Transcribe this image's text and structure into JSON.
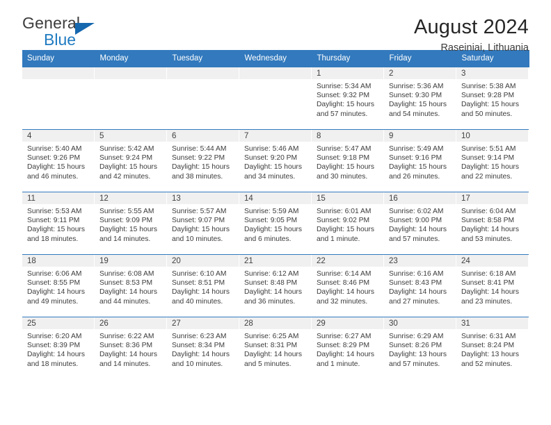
{
  "brand": {
    "name_line1": "General",
    "name_line2": "Blue",
    "triangle_icon": "blue-triangle-logo-mark",
    "color_dark": "#3c3c3c",
    "color_blue": "#1f7bc1"
  },
  "header": {
    "title": "August 2024",
    "subtitle": "Raseiniai, Lithuania"
  },
  "theme": {
    "header_band": "#3279bd",
    "daynum_band": "#f0f0f0",
    "text": "#3b3b3b"
  },
  "weekdays": [
    "Sunday",
    "Monday",
    "Tuesday",
    "Wednesday",
    "Thursday",
    "Friday",
    "Saturday"
  ],
  "labels": {
    "sunrise_prefix": "Sunrise:",
    "sunset_prefix": "Sunset:",
    "daylight_prefix": "Daylight:"
  },
  "weeks": [
    [
      {
        "day": "",
        "sunrise": "",
        "sunset": "",
        "daylight_line1": "",
        "daylight_line2": ""
      },
      {
        "day": "",
        "sunrise": "",
        "sunset": "",
        "daylight_line1": "",
        "daylight_line2": ""
      },
      {
        "day": "",
        "sunrise": "",
        "sunset": "",
        "daylight_line1": "",
        "daylight_line2": ""
      },
      {
        "day": "",
        "sunrise": "",
        "sunset": "",
        "daylight_line1": "",
        "daylight_line2": ""
      },
      {
        "day": "1",
        "sunrise": "Sunrise: 5:34 AM",
        "sunset": "Sunset: 9:32 PM",
        "daylight_line1": "Daylight: 15 hours",
        "daylight_line2": "and 57 minutes."
      },
      {
        "day": "2",
        "sunrise": "Sunrise: 5:36 AM",
        "sunset": "Sunset: 9:30 PM",
        "daylight_line1": "Daylight: 15 hours",
        "daylight_line2": "and 54 minutes."
      },
      {
        "day": "3",
        "sunrise": "Sunrise: 5:38 AM",
        "sunset": "Sunset: 9:28 PM",
        "daylight_line1": "Daylight: 15 hours",
        "daylight_line2": "and 50 minutes."
      }
    ],
    [
      {
        "day": "4",
        "sunrise": "Sunrise: 5:40 AM",
        "sunset": "Sunset: 9:26 PM",
        "daylight_line1": "Daylight: 15 hours",
        "daylight_line2": "and 46 minutes."
      },
      {
        "day": "5",
        "sunrise": "Sunrise: 5:42 AM",
        "sunset": "Sunset: 9:24 PM",
        "daylight_line1": "Daylight: 15 hours",
        "daylight_line2": "and 42 minutes."
      },
      {
        "day": "6",
        "sunrise": "Sunrise: 5:44 AM",
        "sunset": "Sunset: 9:22 PM",
        "daylight_line1": "Daylight: 15 hours",
        "daylight_line2": "and 38 minutes."
      },
      {
        "day": "7",
        "sunrise": "Sunrise: 5:46 AM",
        "sunset": "Sunset: 9:20 PM",
        "daylight_line1": "Daylight: 15 hours",
        "daylight_line2": "and 34 minutes."
      },
      {
        "day": "8",
        "sunrise": "Sunrise: 5:47 AM",
        "sunset": "Sunset: 9:18 PM",
        "daylight_line1": "Daylight: 15 hours",
        "daylight_line2": "and 30 minutes."
      },
      {
        "day": "9",
        "sunrise": "Sunrise: 5:49 AM",
        "sunset": "Sunset: 9:16 PM",
        "daylight_line1": "Daylight: 15 hours",
        "daylight_line2": "and 26 minutes."
      },
      {
        "day": "10",
        "sunrise": "Sunrise: 5:51 AM",
        "sunset": "Sunset: 9:14 PM",
        "daylight_line1": "Daylight: 15 hours",
        "daylight_line2": "and 22 minutes."
      }
    ],
    [
      {
        "day": "11",
        "sunrise": "Sunrise: 5:53 AM",
        "sunset": "Sunset: 9:11 PM",
        "daylight_line1": "Daylight: 15 hours",
        "daylight_line2": "and 18 minutes."
      },
      {
        "day": "12",
        "sunrise": "Sunrise: 5:55 AM",
        "sunset": "Sunset: 9:09 PM",
        "daylight_line1": "Daylight: 15 hours",
        "daylight_line2": "and 14 minutes."
      },
      {
        "day": "13",
        "sunrise": "Sunrise: 5:57 AM",
        "sunset": "Sunset: 9:07 PM",
        "daylight_line1": "Daylight: 15 hours",
        "daylight_line2": "and 10 minutes."
      },
      {
        "day": "14",
        "sunrise": "Sunrise: 5:59 AM",
        "sunset": "Sunset: 9:05 PM",
        "daylight_line1": "Daylight: 15 hours",
        "daylight_line2": "and 6 minutes."
      },
      {
        "day": "15",
        "sunrise": "Sunrise: 6:01 AM",
        "sunset": "Sunset: 9:02 PM",
        "daylight_line1": "Daylight: 15 hours",
        "daylight_line2": "and 1 minute."
      },
      {
        "day": "16",
        "sunrise": "Sunrise: 6:02 AM",
        "sunset": "Sunset: 9:00 PM",
        "daylight_line1": "Daylight: 14 hours",
        "daylight_line2": "and 57 minutes."
      },
      {
        "day": "17",
        "sunrise": "Sunrise: 6:04 AM",
        "sunset": "Sunset: 8:58 PM",
        "daylight_line1": "Daylight: 14 hours",
        "daylight_line2": "and 53 minutes."
      }
    ],
    [
      {
        "day": "18",
        "sunrise": "Sunrise: 6:06 AM",
        "sunset": "Sunset: 8:55 PM",
        "daylight_line1": "Daylight: 14 hours",
        "daylight_line2": "and 49 minutes."
      },
      {
        "day": "19",
        "sunrise": "Sunrise: 6:08 AM",
        "sunset": "Sunset: 8:53 PM",
        "daylight_line1": "Daylight: 14 hours",
        "daylight_line2": "and 44 minutes."
      },
      {
        "day": "20",
        "sunrise": "Sunrise: 6:10 AM",
        "sunset": "Sunset: 8:51 PM",
        "daylight_line1": "Daylight: 14 hours",
        "daylight_line2": "and 40 minutes."
      },
      {
        "day": "21",
        "sunrise": "Sunrise: 6:12 AM",
        "sunset": "Sunset: 8:48 PM",
        "daylight_line1": "Daylight: 14 hours",
        "daylight_line2": "and 36 minutes."
      },
      {
        "day": "22",
        "sunrise": "Sunrise: 6:14 AM",
        "sunset": "Sunset: 8:46 PM",
        "daylight_line1": "Daylight: 14 hours",
        "daylight_line2": "and 32 minutes."
      },
      {
        "day": "23",
        "sunrise": "Sunrise: 6:16 AM",
        "sunset": "Sunset: 8:43 PM",
        "daylight_line1": "Daylight: 14 hours",
        "daylight_line2": "and 27 minutes."
      },
      {
        "day": "24",
        "sunrise": "Sunrise: 6:18 AM",
        "sunset": "Sunset: 8:41 PM",
        "daylight_line1": "Daylight: 14 hours",
        "daylight_line2": "and 23 minutes."
      }
    ],
    [
      {
        "day": "25",
        "sunrise": "Sunrise: 6:20 AM",
        "sunset": "Sunset: 8:39 PM",
        "daylight_line1": "Daylight: 14 hours",
        "daylight_line2": "and 18 minutes."
      },
      {
        "day": "26",
        "sunrise": "Sunrise: 6:22 AM",
        "sunset": "Sunset: 8:36 PM",
        "daylight_line1": "Daylight: 14 hours",
        "daylight_line2": "and 14 minutes."
      },
      {
        "day": "27",
        "sunrise": "Sunrise: 6:23 AM",
        "sunset": "Sunset: 8:34 PM",
        "daylight_line1": "Daylight: 14 hours",
        "daylight_line2": "and 10 minutes."
      },
      {
        "day": "28",
        "sunrise": "Sunrise: 6:25 AM",
        "sunset": "Sunset: 8:31 PM",
        "daylight_line1": "Daylight: 14 hours",
        "daylight_line2": "and 5 minutes."
      },
      {
        "day": "29",
        "sunrise": "Sunrise: 6:27 AM",
        "sunset": "Sunset: 8:29 PM",
        "daylight_line1": "Daylight: 14 hours",
        "daylight_line2": "and 1 minute."
      },
      {
        "day": "30",
        "sunrise": "Sunrise: 6:29 AM",
        "sunset": "Sunset: 8:26 PM",
        "daylight_line1": "Daylight: 13 hours",
        "daylight_line2": "and 57 minutes."
      },
      {
        "day": "31",
        "sunrise": "Sunrise: 6:31 AM",
        "sunset": "Sunset: 8:24 PM",
        "daylight_line1": "Daylight: 13 hours",
        "daylight_line2": "and 52 minutes."
      }
    ]
  ]
}
